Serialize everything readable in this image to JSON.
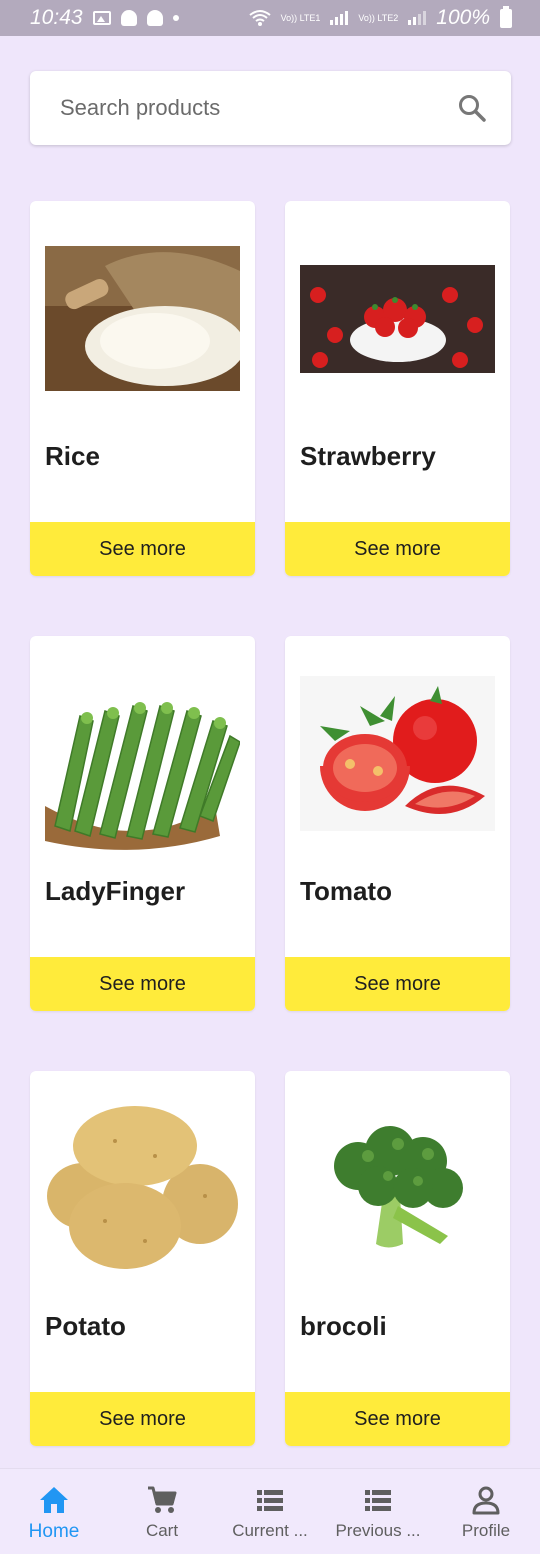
{
  "status_bar": {
    "time": "10:43",
    "battery": "100%",
    "net1": "Vo)) LTE1",
    "net2": "Vo)) LTE2"
  },
  "search": {
    "placeholder": "Search products"
  },
  "products": [
    {
      "name": "Rice",
      "button": "See more"
    },
    {
      "name": "Strawberry",
      "button": "See more"
    },
    {
      "name": "LadyFinger",
      "button": "See more"
    },
    {
      "name": "Tomato",
      "button": "See more"
    },
    {
      "name": "Potato",
      "button": "See more"
    },
    {
      "name": "brocoli",
      "button": "See more"
    }
  ],
  "bottom_nav": {
    "items": [
      {
        "label": "Home",
        "icon": "home-icon",
        "active": true
      },
      {
        "label": "Cart",
        "icon": "cart-icon",
        "active": false
      },
      {
        "label": "Current ...",
        "icon": "list-icon",
        "active": false
      },
      {
        "label": "Previous ...",
        "icon": "list-icon",
        "active": false
      },
      {
        "label": "Profile",
        "icon": "person-icon",
        "active": false
      }
    ]
  },
  "colors": {
    "background": "#efe6fb",
    "button": "#ffeb3b",
    "nav_active": "#2196f3"
  }
}
